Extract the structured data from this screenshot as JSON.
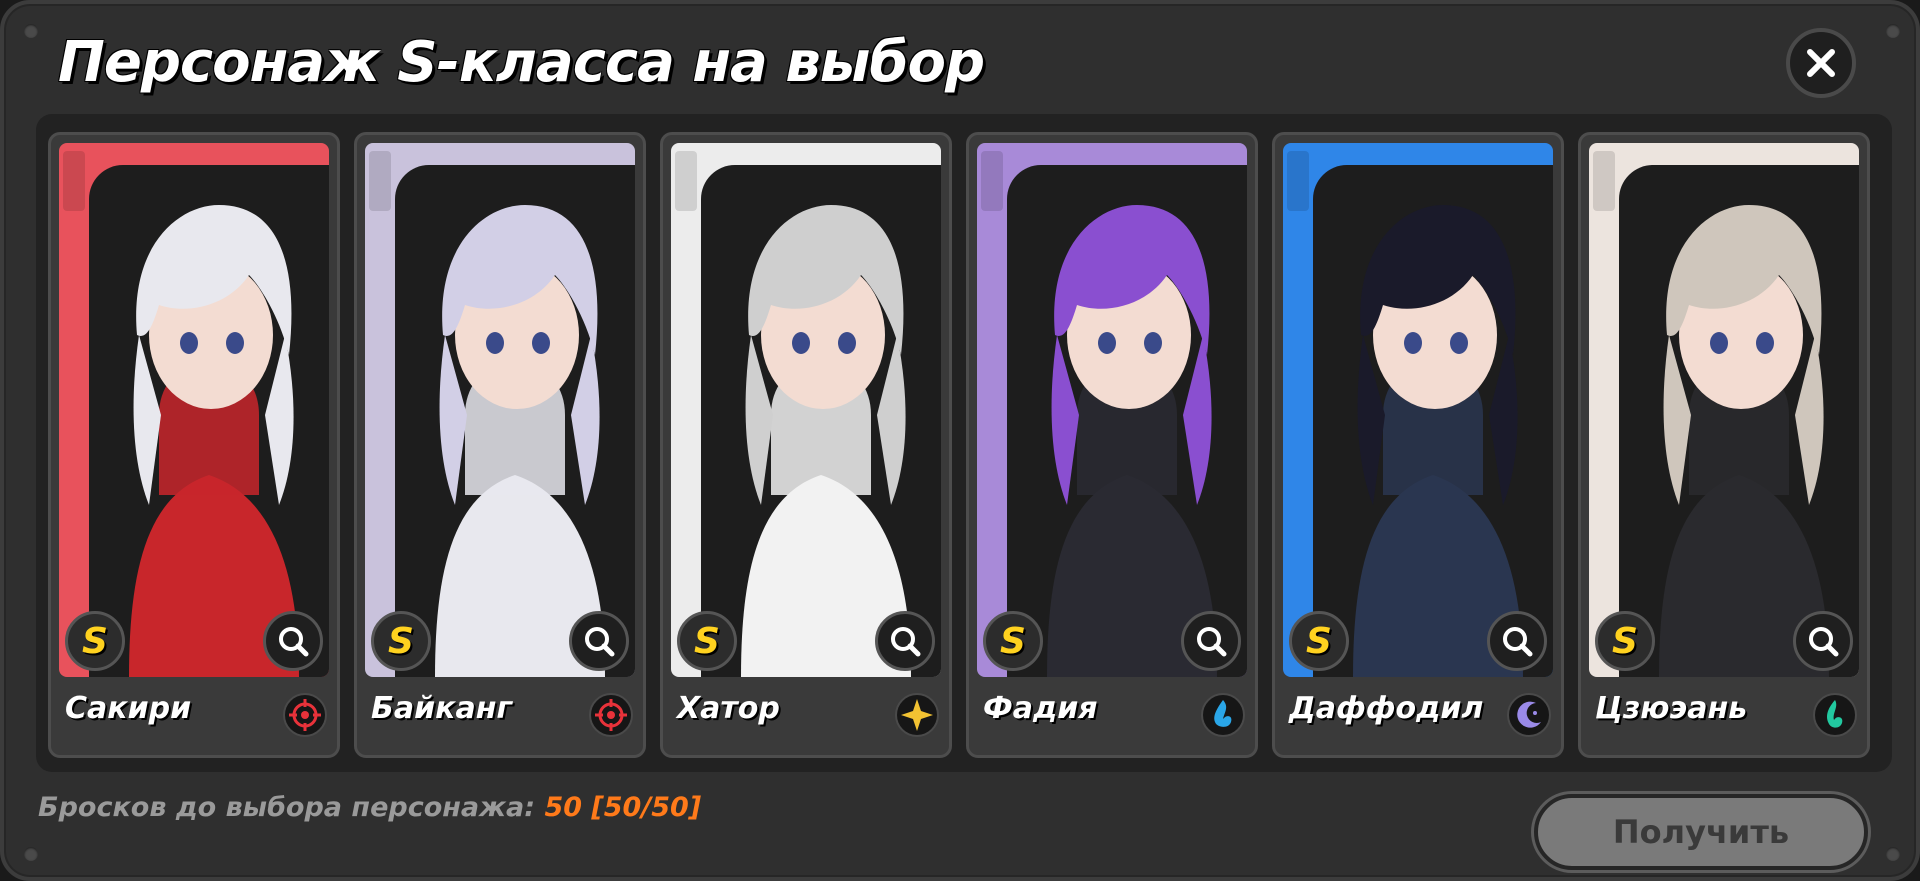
{
  "title": "Персонаж S-класса на выбор",
  "footer": {
    "label": "Бросков до выбора персонажа:",
    "count": "50 [50/50]"
  },
  "get_button_label": "Получить",
  "colors": {
    "accent_orange": "#ff7a1a",
    "grade_yellow": "#ffd21f"
  },
  "cards": [
    {
      "name": "Сакири",
      "grade": "S",
      "element_icon": "physical-icon",
      "element_color": "#e8323a",
      "bg": "#e8525c",
      "hair": "#e8e8ee",
      "outfit": "#c8262b"
    },
    {
      "name": "Байканг",
      "grade": "S",
      "element_icon": "physical-icon",
      "element_color": "#e8323a",
      "bg": "#c9c2dc",
      "hair": "#d2cfe6",
      "outfit": "#e8e8ee"
    },
    {
      "name": "Хатор",
      "grade": "S",
      "element_icon": "light-icon",
      "element_color": "#f2c232",
      "bg": "#ececec",
      "hair": "#cfcfcf",
      "outfit": "#f2f2f2"
    },
    {
      "name": "Фадия",
      "grade": "S",
      "element_icon": "water-icon",
      "element_color": "#2aa6e8",
      "bg": "#a88ad8",
      "hair": "#8a4fd0",
      "outfit": "#2a2a32"
    },
    {
      "name": "Даффодил",
      "grade": "S",
      "element_icon": "dark-icon",
      "element_color": "#9a8ae8",
      "bg": "#2f86e8",
      "hair": "#1a1a2a",
      "outfit": "#2a3650"
    },
    {
      "name": "Цзюэань",
      "grade": "S",
      "element_icon": "wind-icon",
      "element_color": "#22c9a0",
      "bg": "#ece4de",
      "hair": "#cfc6bc",
      "outfit": "#2a2a2e"
    }
  ]
}
